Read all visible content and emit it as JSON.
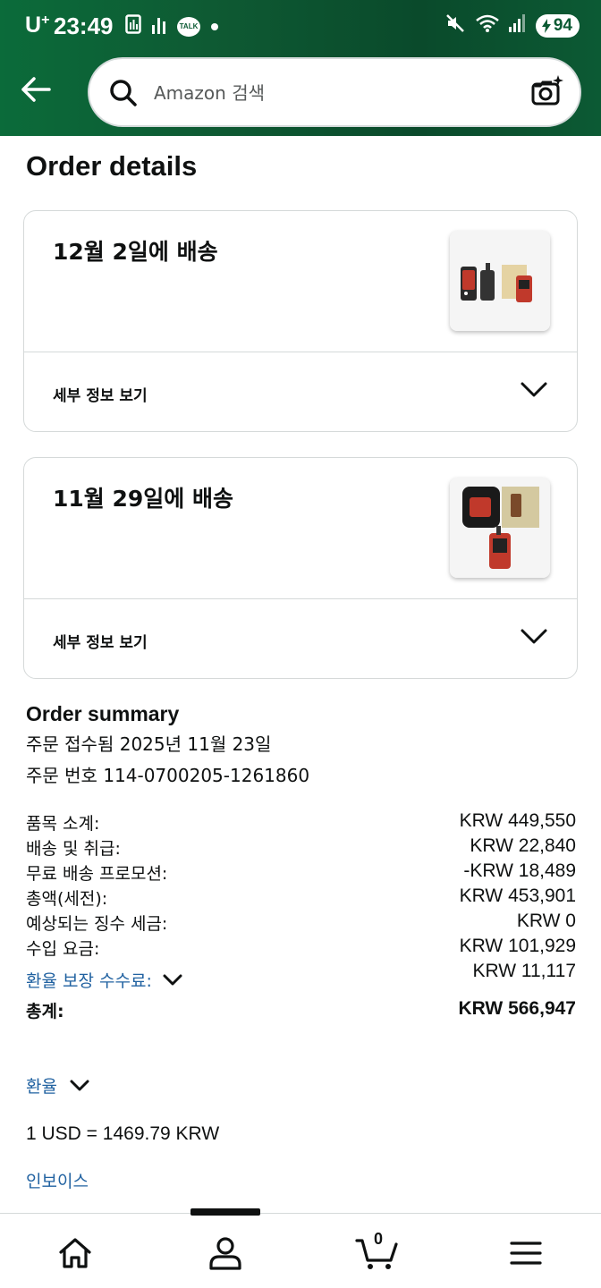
{
  "status_bar": {
    "carrier": "U",
    "carrier_sup": "+",
    "time": "23:49",
    "battery": "94",
    "talk_badge": "TALK"
  },
  "search": {
    "placeholder": "Amazon 검색"
  },
  "page": {
    "title": "Order details"
  },
  "shipments": [
    {
      "delivery": "12월 2일에 배송",
      "details_label": "세부 정보 보기"
    },
    {
      "delivery": "11월 29일에 배송",
      "details_label": "세부 정보 보기"
    }
  ],
  "summary": {
    "title": "Order summary",
    "placed": "주문 접수됨 2025년 11월 23일",
    "order_number": "주문 번호 114-0700205-1261860",
    "rows": [
      {
        "label": "품목 소계:",
        "value": "KRW 449,550"
      },
      {
        "label": "배송 및 취급:",
        "value": "KRW 22,840"
      },
      {
        "label": "무료 배송 프로모션:",
        "value": "-KRW 18,489"
      },
      {
        "label": "총액(세전):",
        "value": "KRW 453,901"
      },
      {
        "label": "예상되는 징수 세금:",
        "value": "KRW 0"
      },
      {
        "label": "수입 요금:",
        "value": "KRW 101,929"
      },
      {
        "label": "환율 보장 수수료:",
        "value": "KRW 11,117"
      },
      {
        "label": "총계:",
        "value": "KRW 566,947"
      }
    ],
    "exchange_label": "환율",
    "exchange_rate": "1 USD = 1469.79 KRW",
    "invoice_label": "인보이스"
  },
  "bottom_nav": {
    "cart_count": "0"
  },
  "colors": {
    "header_green": "#0b5a33",
    "link": "#2162a1",
    "border": "#d5d9d9"
  }
}
